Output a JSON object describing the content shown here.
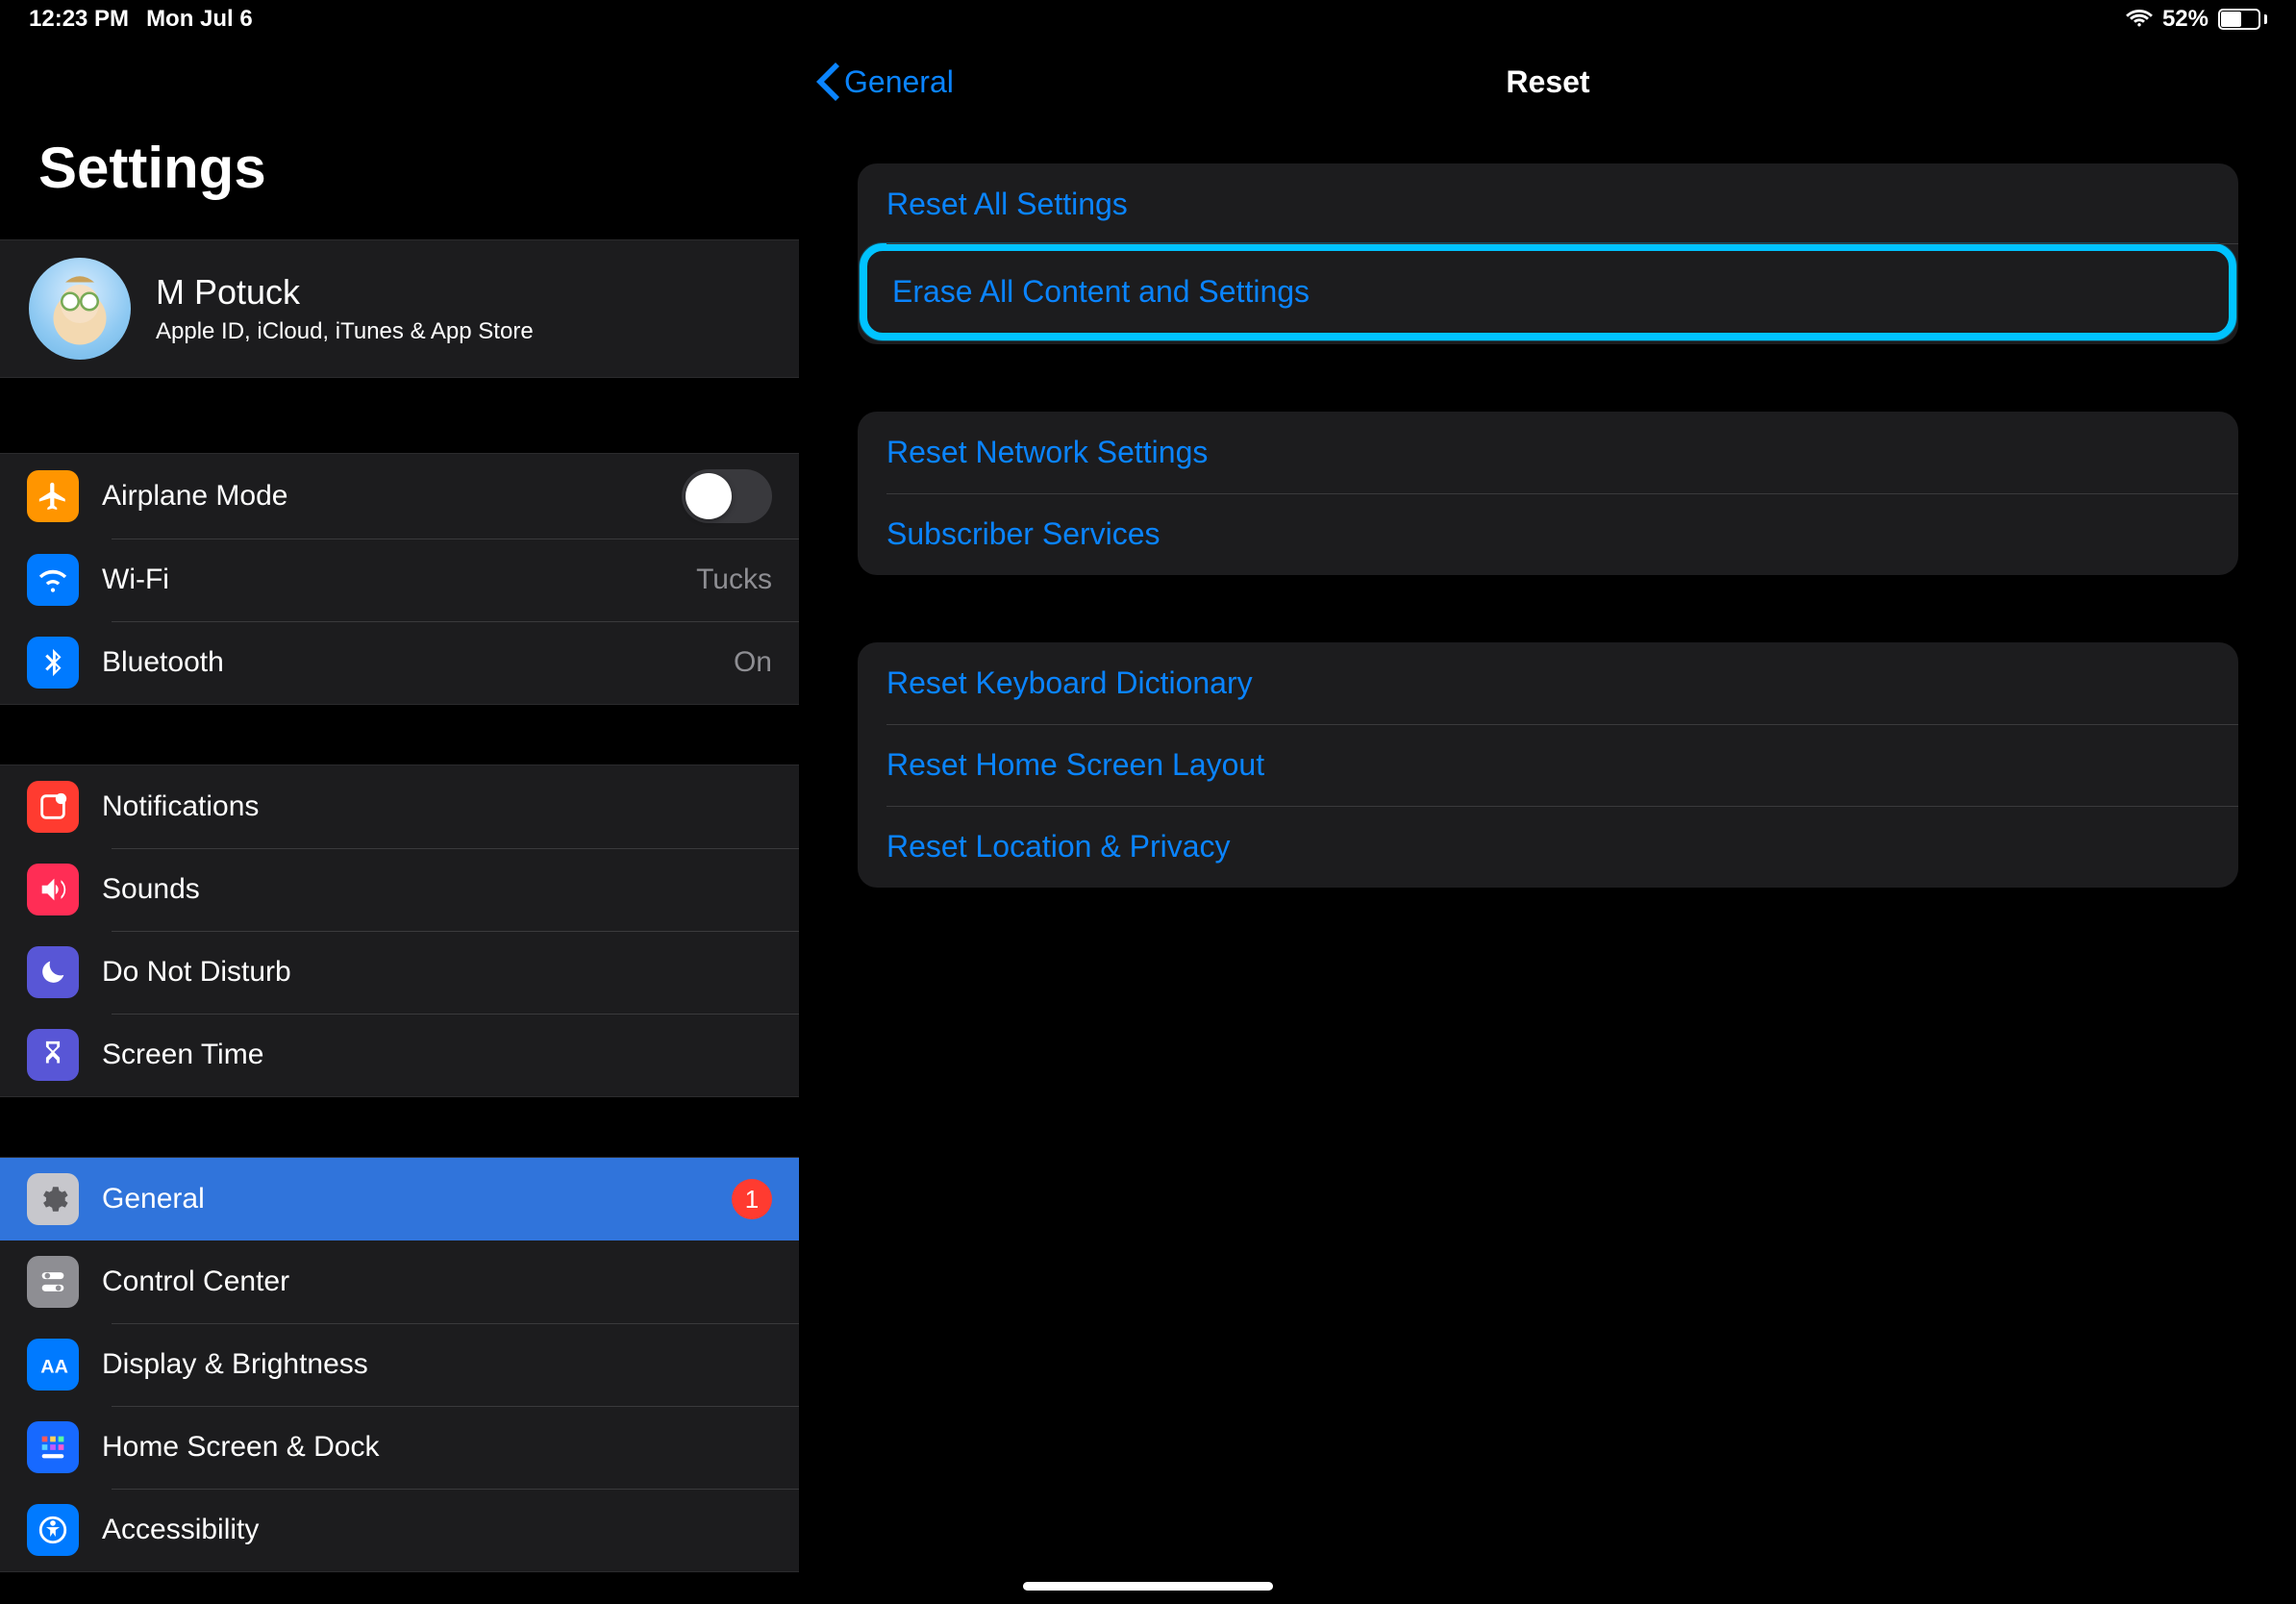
{
  "status": {
    "time": "12:23 PM",
    "date": "Mon Jul 6",
    "battery_pct": "52%"
  },
  "sidebar": {
    "title": "Settings",
    "account": {
      "name": "M Potuck",
      "sub": "Apple ID, iCloud, iTunes & App Store"
    },
    "g1": {
      "airplane": "Airplane Mode",
      "wifi": "Wi-Fi",
      "wifi_value": "Tucks",
      "bt": "Bluetooth",
      "bt_value": "On"
    },
    "g2": {
      "notifications": "Notifications",
      "sounds": "Sounds",
      "dnd": "Do Not Disturb",
      "screentime": "Screen Time"
    },
    "g3": {
      "general": "General",
      "general_badge": "1",
      "control": "Control Center",
      "display": "Display & Brightness",
      "home": "Home Screen & Dock",
      "acc": "Accessibility"
    }
  },
  "detail": {
    "back": "General",
    "title": "Reset",
    "g1": {
      "a": "Reset All Settings",
      "b": "Erase All Content and Settings"
    },
    "g2": {
      "a": "Reset Network Settings",
      "b": "Subscriber Services"
    },
    "g3": {
      "a": "Reset Keyboard Dictionary",
      "b": "Reset Home Screen Layout",
      "c": "Reset Location & Privacy"
    }
  }
}
